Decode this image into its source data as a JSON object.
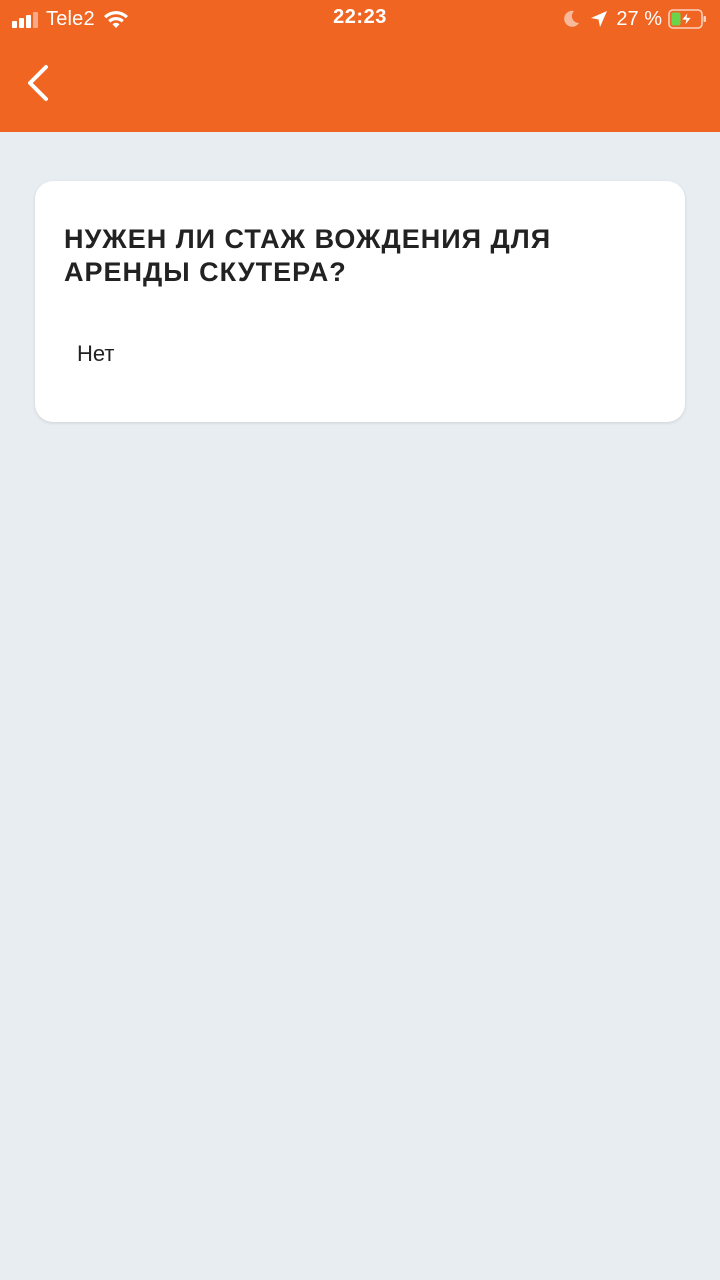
{
  "status_bar": {
    "carrier": "Tele2",
    "time": "22:23",
    "battery_percent": "27 %",
    "icons": [
      "signal-icon",
      "wifi-icon",
      "moon-icon",
      "location-arrow-icon",
      "battery-charging-icon"
    ],
    "colors": {
      "battery_fill": "#6cd44a"
    }
  },
  "header": {
    "background_color": "#f06522",
    "back_icon": "chevron-left-icon"
  },
  "faq": {
    "question": "НУЖЕН ЛИ СТАЖ ВОЖДЕНИЯ ДЛЯ АРЕНДЫ СКУТЕРА?",
    "answer": "Нет"
  },
  "page": {
    "background_color": "#e8edf2"
  }
}
